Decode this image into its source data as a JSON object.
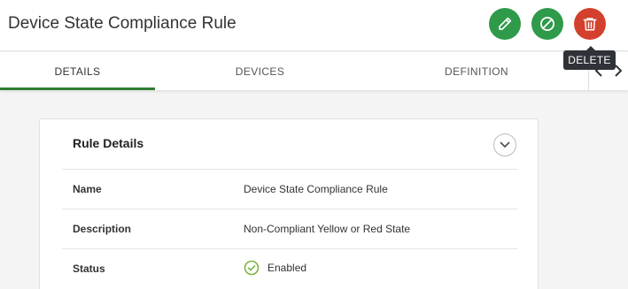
{
  "header": {
    "title": "Device State Compliance Rule",
    "actions": {
      "edit_icon": "pencil-icon",
      "disable_icon": "ban-icon",
      "delete_icon": "trash-icon",
      "delete_tooltip": "DELETE"
    }
  },
  "tabs": [
    {
      "label": "DETAILS",
      "active": true
    },
    {
      "label": "DEVICES",
      "active": false
    },
    {
      "label": "DEFINITION",
      "active": false
    }
  ],
  "card": {
    "title": "Rule Details",
    "rows": [
      {
        "label": "Name",
        "value": "Device State Compliance Rule"
      },
      {
        "label": "Description",
        "value": "Non-Compliant Yellow or Red State"
      },
      {
        "label": "Status",
        "value": "Enabled"
      }
    ]
  },
  "colors": {
    "primary_green": "#2e9a4a",
    "delete_red": "#d3402e",
    "tab_underline": "#2e7d32",
    "status_enabled": "#7cb342"
  }
}
